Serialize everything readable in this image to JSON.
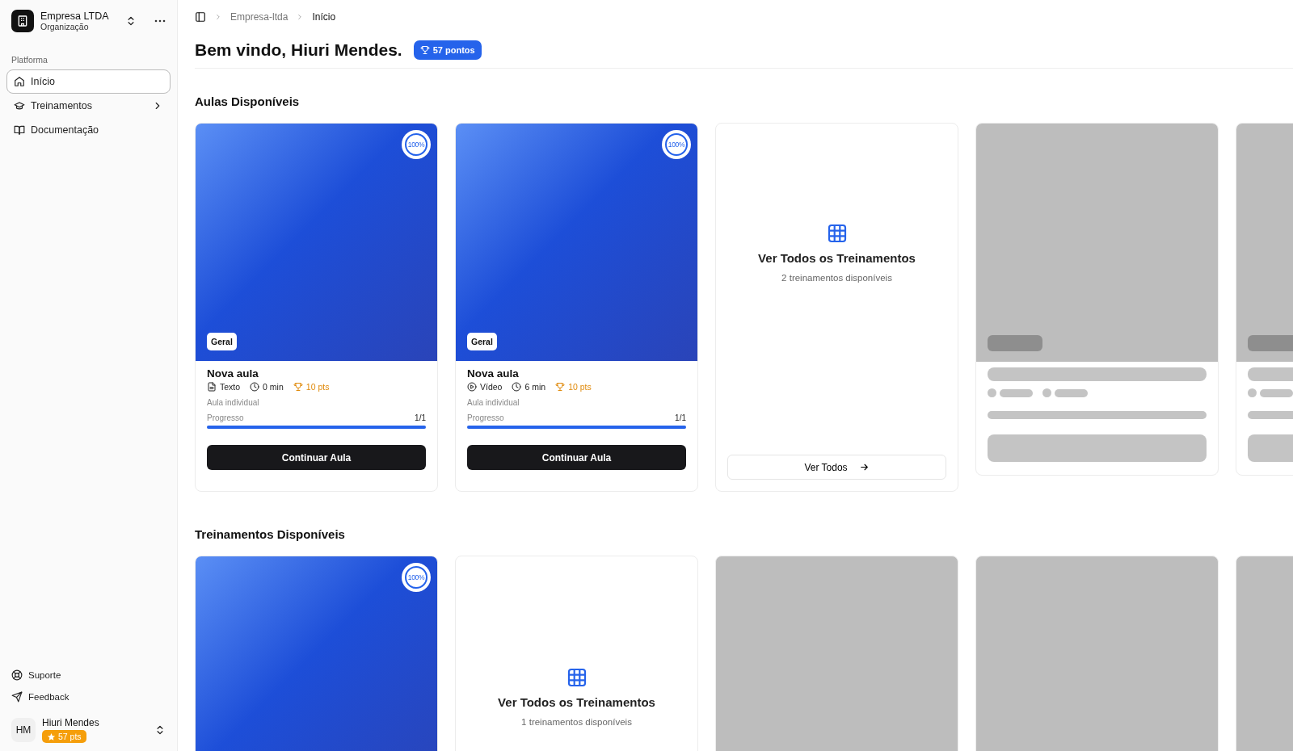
{
  "org": {
    "name": "Empresa LTDA",
    "subtitle": "Organização"
  },
  "sidebar": {
    "group_label": "Platforma",
    "items": [
      {
        "label": "Início",
        "selected": true,
        "expandable": false
      },
      {
        "label": "Treinamentos",
        "selected": false,
        "expandable": true
      },
      {
        "label": "Documentação",
        "selected": false,
        "expandable": false
      }
    ],
    "footer_links": [
      {
        "label": "Suporte"
      },
      {
        "label": "Feedback"
      }
    ],
    "user": {
      "initials": "HM",
      "name": "Hiuri Mendes",
      "points": "57 pts"
    }
  },
  "breadcrumb": [
    "Empresa-ltda",
    "Início"
  ],
  "greeting": "Bem vindo, Hiuri Mendes.",
  "points_badge": "57 pontos",
  "sections": [
    {
      "title": "Aulas Disponíveis",
      "cards": [
        {
          "kind": "lesson",
          "progress_badge": "100%",
          "tag": "Geral",
          "title": "Nova aula",
          "format": {
            "kind": "text",
            "label": "Texto"
          },
          "duration": "0 min",
          "points": "10 pts",
          "subtitle": "Aula individual",
          "progress_label": "Progresso",
          "progress_count": "1/1",
          "level": 1,
          "button": "Continuar Aula"
        },
        {
          "kind": "lesson",
          "progress_badge": "100%",
          "tag": "Geral",
          "title": "Nova aula",
          "format": {
            "kind": "video",
            "label": "Vídeo"
          },
          "duration": "6 min",
          "points": "10 pts",
          "subtitle": "Aula individual",
          "progress_label": "Progresso",
          "progress_count": "1/1",
          "level": 1,
          "button": "Continuar Aula"
        },
        {
          "kind": "view_all",
          "title": "Ver Todos os Treinamentos",
          "subtitle": "2 treinamentos disponíveis",
          "button": "Ver Todos"
        },
        {
          "kind": "skeleton"
        },
        {
          "kind": "skeleton"
        }
      ]
    },
    {
      "title": "Treinamentos Disponíveis",
      "cards": [
        {
          "kind": "training",
          "progress_badge": "100%"
        },
        {
          "kind": "view_all",
          "title": "Ver Todos os Treinamentos",
          "subtitle": "1 treinamentos disponíveis"
        },
        {
          "kind": "skeleton"
        },
        {
          "kind": "skeleton"
        },
        {
          "kind": "skeleton"
        }
      ]
    }
  ]
}
